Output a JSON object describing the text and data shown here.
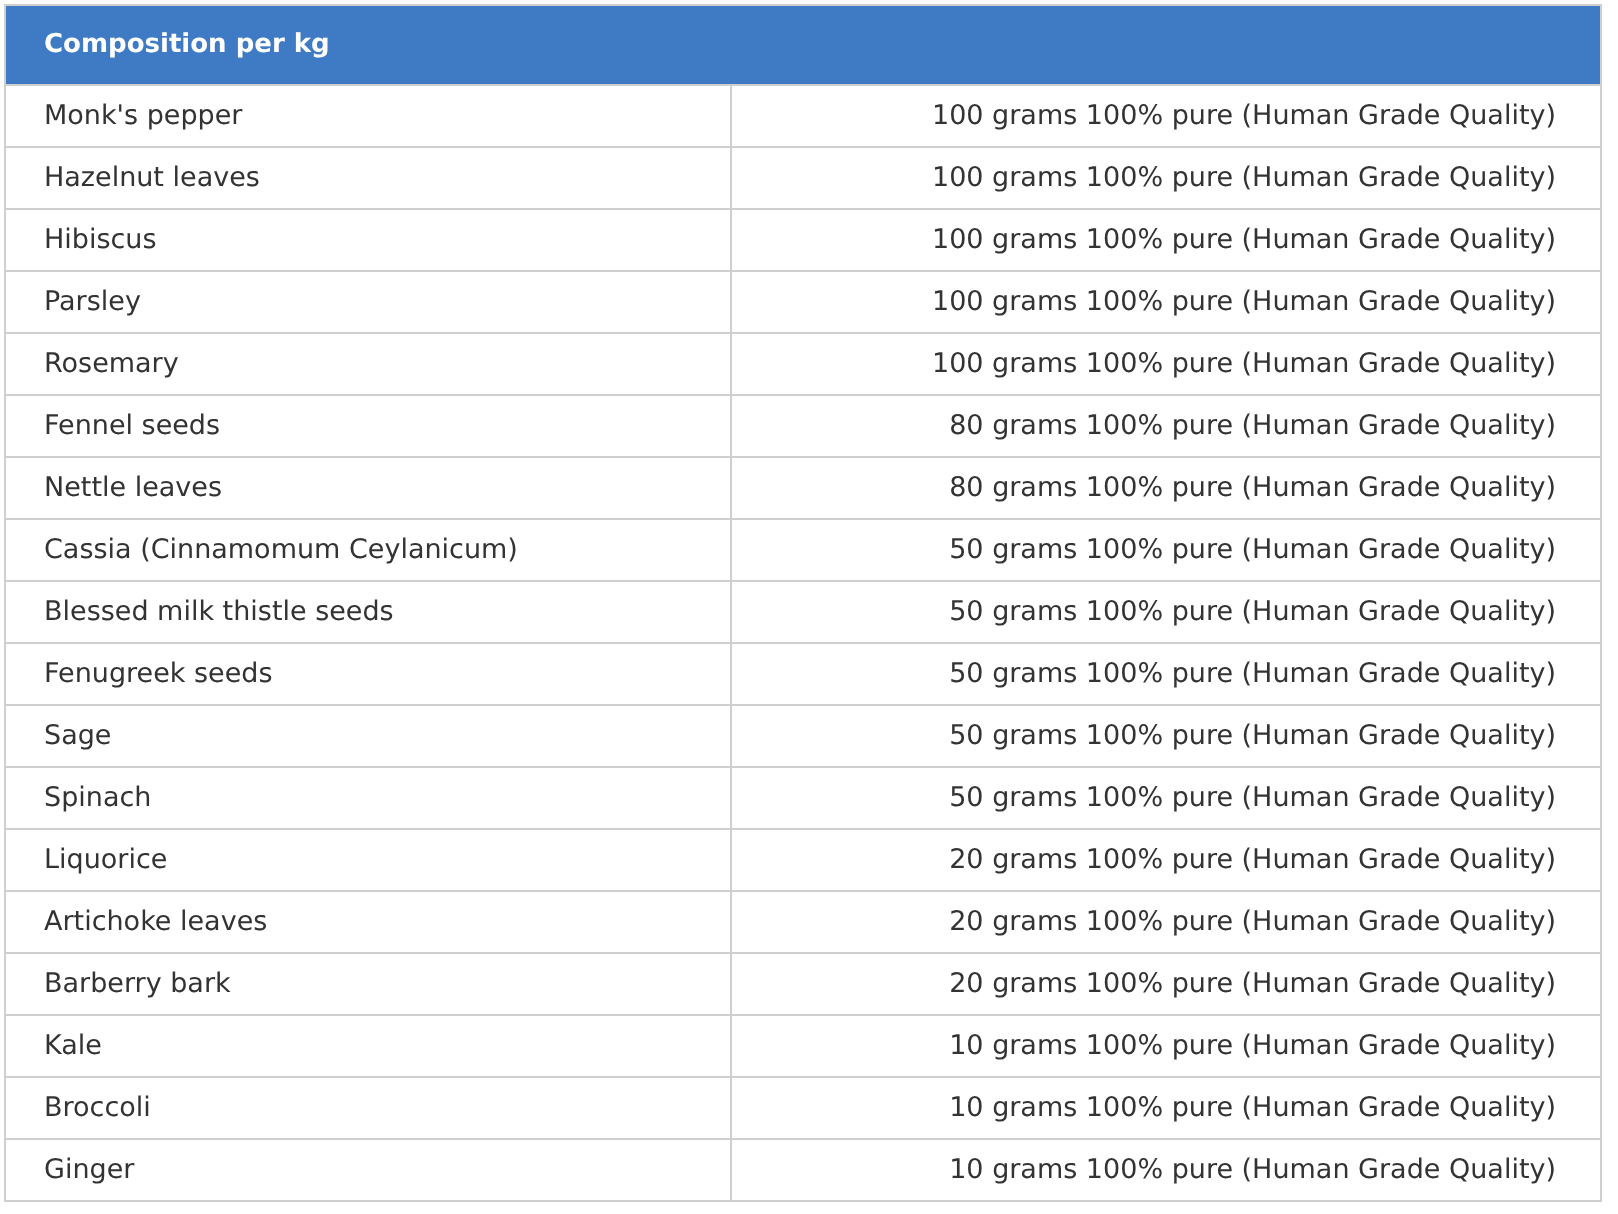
{
  "table": {
    "title": "Composition per kg",
    "rows": [
      {
        "ingredient": "Monk's pepper",
        "amount": "100 grams 100% pure (Human Grade Quality)"
      },
      {
        "ingredient": "Hazelnut leaves",
        "amount": "100 grams 100% pure (Human Grade Quality)"
      },
      {
        "ingredient": "Hibiscus",
        "amount": "100 grams 100% pure (Human Grade Quality)"
      },
      {
        "ingredient": "Parsley",
        "amount": "100 grams 100% pure (Human Grade Quality)"
      },
      {
        "ingredient": "Rosemary",
        "amount": "100 grams 100% pure (Human Grade Quality)"
      },
      {
        "ingredient": "Fennel seeds",
        "amount": "80 grams 100% pure (Human Grade Quality)"
      },
      {
        "ingredient": "Nettle leaves",
        "amount": "80 grams 100% pure (Human Grade Quality)"
      },
      {
        "ingredient": "Cassia (Cinnamomum Ceylanicum)",
        "amount": "50 grams 100% pure (Human Grade Quality)"
      },
      {
        "ingredient": "Blessed milk thistle seeds",
        "amount": "50 grams 100% pure (Human Grade Quality)"
      },
      {
        "ingredient": "Fenugreek seeds",
        "amount": "50 grams 100% pure (Human Grade Quality)"
      },
      {
        "ingredient": "Sage",
        "amount": "50 grams 100% pure (Human Grade Quality)"
      },
      {
        "ingredient": "Spinach",
        "amount": "50 grams 100% pure (Human Grade Quality)"
      },
      {
        "ingredient": "Liquorice",
        "amount": "20 grams 100% pure (Human Grade Quality)"
      },
      {
        "ingredient": "Artichoke leaves",
        "amount": "20 grams 100% pure (Human Grade Quality)"
      },
      {
        "ingredient": "Barberry bark",
        "amount": "20 grams 100% pure (Human Grade Quality)"
      },
      {
        "ingredient": "Kale",
        "amount": "10 grams 100% pure (Human Grade Quality)"
      },
      {
        "ingredient": "Broccoli",
        "amount": "10 grams 100% pure (Human Grade Quality)"
      },
      {
        "ingredient": "Ginger",
        "amount": "10 grams 100% pure (Human Grade Quality)"
      }
    ]
  }
}
